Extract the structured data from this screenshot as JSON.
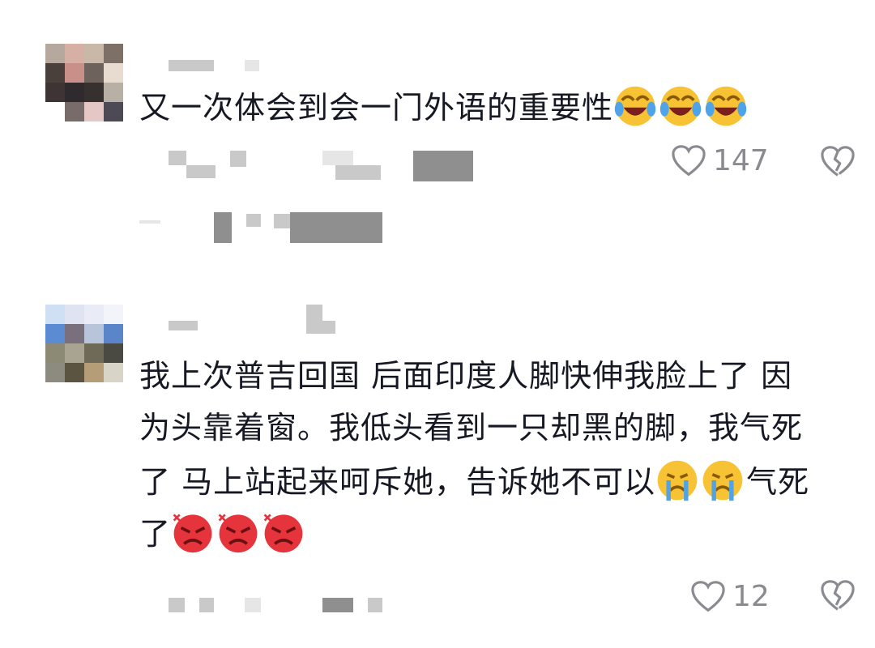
{
  "comments": [
    {
      "text": "又一次体会到会一门外语的重要性",
      "emojis": [
        "laughing-crying-emoji",
        "laughing-crying-emoji",
        "laughing-crying-emoji"
      ],
      "likes": "147"
    },
    {
      "line1": "我上次普吉回国 后面印度人脚快伸我脸上了 因",
      "line2": "为头靠着窗。我低头看到一只却黑的脚，我气死",
      "line3": "了 马上站起来呵斥她，告诉她不可以",
      "line3b": "气死",
      "line4": "了",
      "likes": "12"
    }
  ],
  "icons": [
    "heart-outline-icon",
    "broken-heart-icon"
  ],
  "colors": {
    "text": "#161823",
    "muted": "#8a8b91",
    "angry": "#e5343b",
    "emoji_yellow": "#f7c234"
  }
}
